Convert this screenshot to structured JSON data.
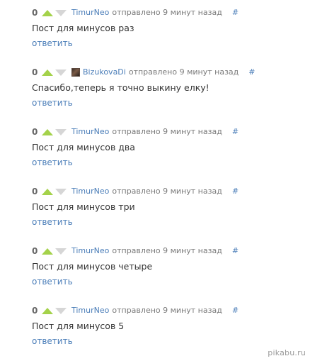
{
  "comments": [
    {
      "rating": "0",
      "author": "TimurNeo",
      "posted": "отправлено 9 минут назад",
      "anchor": "#",
      "text": "Пост для минусов раз",
      "reply": "ответить",
      "has_avatar": false
    },
    {
      "rating": "0",
      "author": "BizukovaDi",
      "posted": "отправлено 9 минут назад",
      "anchor": "#",
      "text": "Спасибо,теперь я точно выкину елку!",
      "reply": "ответить",
      "has_avatar": true
    },
    {
      "rating": "0",
      "author": "TimurNeo",
      "posted": "отправлено 9 минут назад",
      "anchor": "#",
      "text": "Пост для минусов два",
      "reply": "ответить",
      "has_avatar": false
    },
    {
      "rating": "0",
      "author": "TimurNeo",
      "posted": "отправлено 9 минут назад",
      "anchor": "#",
      "text": "Пост для минусов три",
      "reply": "ответить",
      "has_avatar": false
    },
    {
      "rating": "0",
      "author": "TimurNeo",
      "posted": "отправлено 9 минут назад",
      "anchor": "#",
      "text": "Пост для минусов четыре",
      "reply": "ответить",
      "has_avatar": false
    },
    {
      "rating": "0",
      "author": "TimurNeo",
      "posted": "отправлено 9 минут назад",
      "anchor": "#",
      "text": "Пост для минусов 5",
      "reply": "ответить",
      "has_avatar": false
    }
  ],
  "icons": {
    "vote_up": "upvote-arrow-icon",
    "vote_down": "downvote-arrow-icon",
    "avatar": "user-avatar"
  },
  "colors": {
    "link": "#4a7db8",
    "vote_up": "#a4d24a",
    "vote_down": "#d6d6d6",
    "rating": "#666666",
    "text": "#333333",
    "meta": "#7a7a7a"
  },
  "watermark": "pikabu.ru"
}
